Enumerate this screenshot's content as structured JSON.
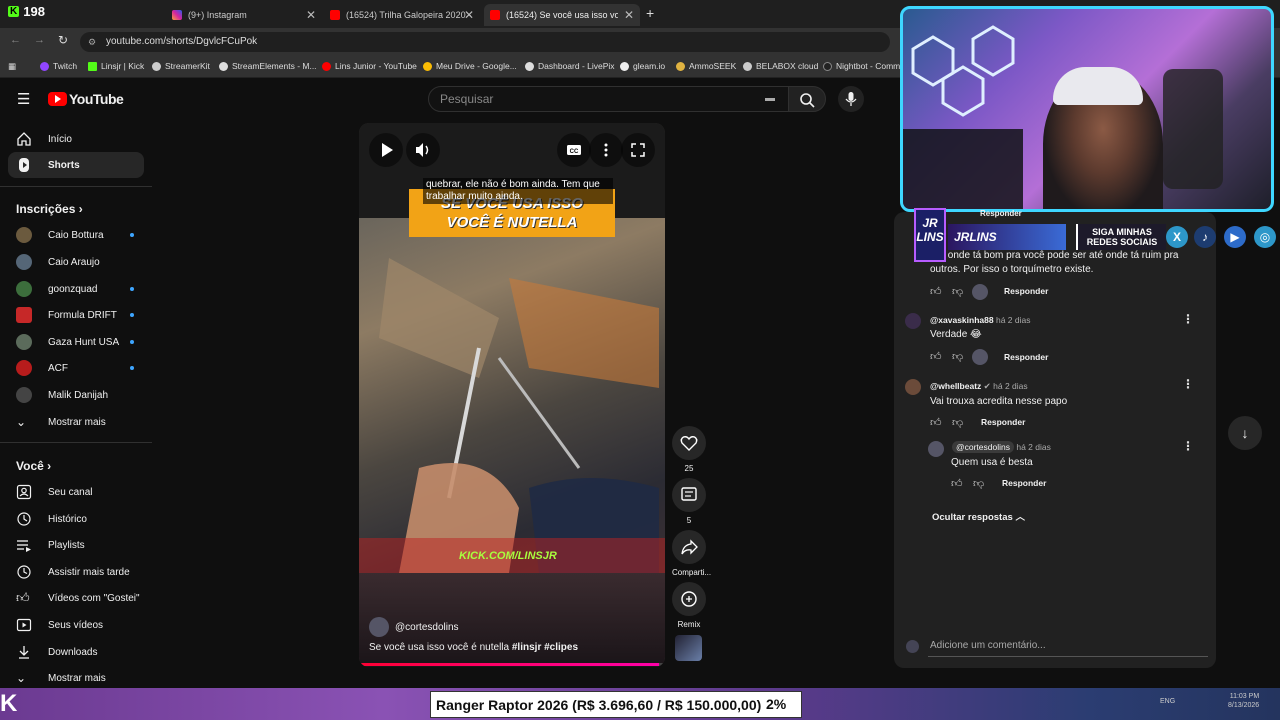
{
  "browser": {
    "kick_viewer_count": "198",
    "tabs": [
      {
        "label": "(9+) Instagram"
      },
      {
        "label": "(16524) Trilha Galopeira 2020 -"
      },
      {
        "label": "(16524) Se você usa isso você é"
      }
    ],
    "url": "youtube.com/shorts/DgvlcFCuPok",
    "bookmarks": [
      "Twitch",
      "Linsjr | Kick",
      "StreamerKit",
      "StreamElements - M...",
      "Lins Junior - YouTube",
      "Meu Drive - Google...",
      "Dashboard - LivePix",
      "gleam.io",
      "AmmoSEEK",
      "BELABOX cloud",
      "Nightbot - Comm"
    ]
  },
  "youtube": {
    "logo_text": "YouTube",
    "search_placeholder": "Pesquisar",
    "sidebar": {
      "top": [
        {
          "label": "Início"
        },
        {
          "label": "Shorts"
        }
      ],
      "subscriptions_title": "Inscrições",
      "subscriptions": [
        {
          "label": "Caio Bottura",
          "dot": true,
          "color": "#6b5a3e"
        },
        {
          "label": "Caio Araujo",
          "dot": false,
          "color": "#556677"
        },
        {
          "label": "goonzquad",
          "dot": true,
          "color": "#3c6e3c"
        },
        {
          "label": "Formula DRIFT",
          "dot": true,
          "color": "#c62828"
        },
        {
          "label": "Gaza Hunt USA",
          "dot": true,
          "color": "#5b6b5b"
        },
        {
          "label": "ACF",
          "dot": true,
          "color": "#b71c1c"
        },
        {
          "label": "Malik Danijah",
          "dot": false,
          "color": "#444"
        }
      ],
      "show_more": "Mostrar mais",
      "you_title": "Você",
      "you": [
        {
          "label": "Seu canal"
        },
        {
          "label": "Histórico"
        },
        {
          "label": "Playlists"
        },
        {
          "label": "Assistir mais tarde"
        },
        {
          "label": "Vídeos com \"Gostei\""
        },
        {
          "label": "Seus vídeos"
        },
        {
          "label": "Downloads"
        }
      ],
      "show_more_2": "Mostrar mais"
    },
    "video": {
      "caption": "quebrar, ele não é bom ainda. Tem que trabalhar muito ainda.",
      "banner_line1": "SE VOCÊ USA ISSO",
      "banner_line2": "VOCÊ É NUTELLA",
      "kick_watermark": "KICK.COM/LINSJR",
      "channel": "@cortesdolins",
      "title": "Se você usa isso você é nutella",
      "hashtags": "#linsjr #clipes",
      "progress": 0.98
    },
    "actions": {
      "likes": "25",
      "comments": "5",
      "share": "Comparti...",
      "remix": "Remix"
    },
    "comments": {
      "partial_text": "Até onde tá bom pra você pode ser até onde tá ruim pra outros. Por isso o torquímetro existe.",
      "reply_label": "Responder",
      "items": [
        {
          "author": "@xavaskinha88",
          "time": "há 2 dias",
          "text": "Verdade 😂"
        },
        {
          "author": "@whellbeatz",
          "time": "há 2 dias",
          "text": "Vai trouxa acredita nesse papo"
        }
      ],
      "reply": {
        "author": "@cortesdolins",
        "time": "há 2 dias",
        "text": "Quem usa é besta"
      },
      "hide_replies": "Ocultar respostas",
      "add_comment_placeholder": "Adicione um comentário..."
    }
  },
  "stream_overlay": {
    "top_reply": "Responder",
    "logo_text": "JR LINS",
    "name": "JRLINS",
    "social_title": "SIGA MINHAS REDES SOCIAIS",
    "social_icons": [
      "x-icon",
      "tiktok-icon",
      "youtube-icon",
      "instagram-icon"
    ],
    "goal_text": "Ranger Raptor 2026 (R$ 3.696,60 / R$ 150.000,00)",
    "goal_percent": "2%",
    "clock_time": "11:03 PM",
    "clock_date": "8/13/2026",
    "tray_lang": "ENG"
  }
}
